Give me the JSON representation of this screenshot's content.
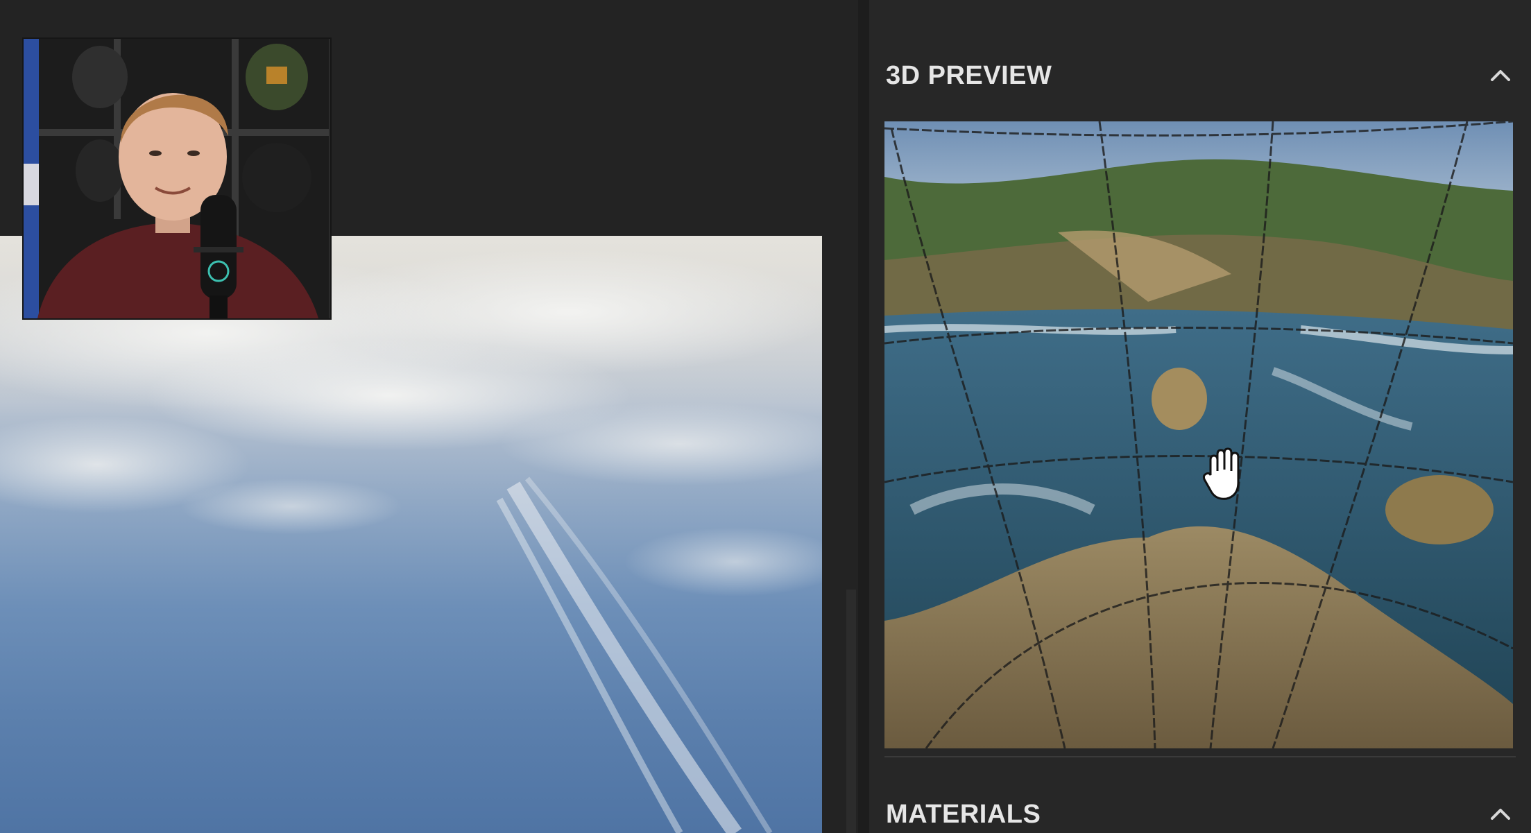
{
  "right_panel": {
    "preview_section": {
      "title": "3D PREVIEW",
      "collapse_icon": "chevron-up-icon"
    },
    "materials_section": {
      "title": "MATERIALS",
      "collapse_icon": "chevron-up-icon"
    },
    "cursor_icon": "hand-grab-icon"
  },
  "colors": {
    "panel_bg": "#272727",
    "canvas_bg": "#232323",
    "header_text": "#e6e6e6"
  }
}
